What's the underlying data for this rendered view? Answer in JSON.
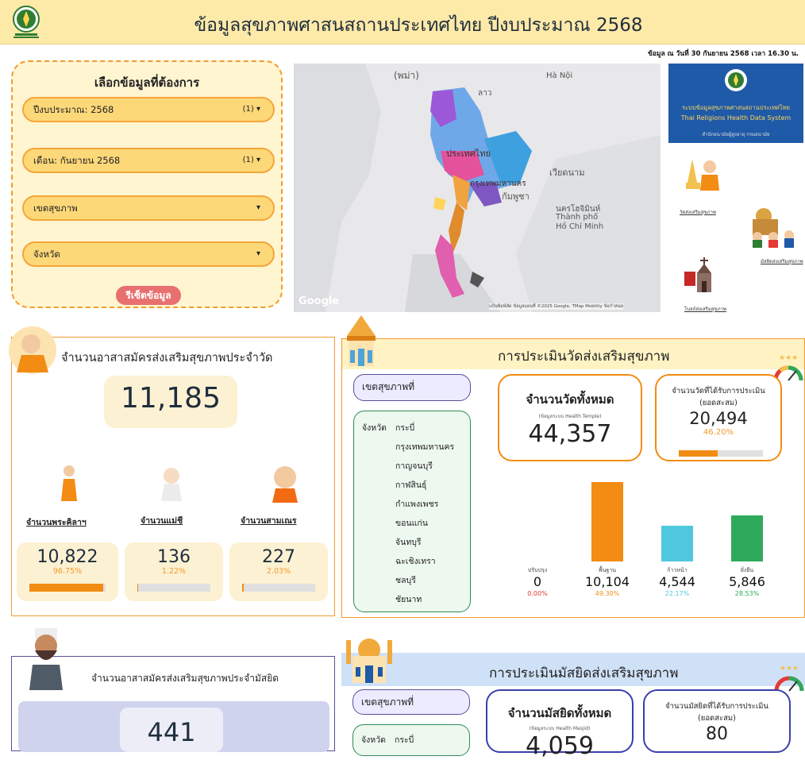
{
  "header": {
    "title": "ข้อมูลสุขภาพศาสนสถานประเทศไทย ปีงบประมาณ 2568"
  },
  "as_of": "ข้อมูล ณ วันที่ 30 กันยายน 2568 เวลา 16.30 น.",
  "filter": {
    "title": "เลือกข้อมูลที่ต้องการ",
    "fiscal_year": {
      "label": "ปีงบประมาณ: 2568",
      "count": "(1)"
    },
    "month": {
      "label": "เดือน: กันยายน 2568",
      "count": "(1)"
    },
    "health_zone": {
      "label": "เขตสุขภาพ"
    },
    "province": {
      "label": "จังหวัด"
    },
    "reset": "รีเซ็ตข้อมูล"
  },
  "map": {
    "labels": [
      "(พม่า)",
      "Hà Nội",
      "ลาว",
      "เวียดนาม",
      "กัมพูชา",
      "ประเทศไทย",
      "กรุงเทพมหานคร",
      "นครโฮจิมินห์",
      "Thành phố",
      "Hồ Chí Minh"
    ],
    "google": "Google",
    "attribution": "แป้นพิมพ์ลัด   ข้อมูลแผนที่ ©2025 Google, TMap Mobility   ข้อกำหนด"
  },
  "banner": {
    "line1": "ระบบข้อมูลสุขภาพศาสนสถานประเทศไทย",
    "line2": "Thai Religions Health Data System",
    "line3": "สำนักอนามัยผู้สูงอายุ กรมอนามัย"
  },
  "side_links": {
    "temple": "วัดส่งเสริมสุขภาพ",
    "mosque": "มัสยิดส่งเสริมสุขภาพ",
    "church": "โบสถ์ส่งเสริมสุขภาพ"
  },
  "temple_volunteers": {
    "title": "จำนวนอาสาสมัครส่งเสริมสุขภาพประจำวัด",
    "total": "11,185",
    "groups": [
      {
        "label": "จำนวนพระคิลาฯ",
        "value": "10,822",
        "pct": "96.75%",
        "fill": 96.75
      },
      {
        "label": "จำนวนแม่ชี",
        "value": "136",
        "pct": "1.22%",
        "fill": 1.22
      },
      {
        "label": "จำนวนสามเณร",
        "value": "227",
        "pct": "2.03%",
        "fill": 2.03
      }
    ]
  },
  "temple_assessment": {
    "title": "การประเมินวัดส่งเสริมสุขภาพ",
    "zone_label": "เขตสุขภาพที่",
    "province_label": "จังหวัด",
    "provinces": [
      "กระบี่",
      "กรุงเทพมหานคร",
      "กาญจนบุรี",
      "กาฬสินธุ์",
      "กำแพงเพชร",
      "ขอนแก่น",
      "จันทบุรี",
      "ฉะเชิงเทรา",
      "ชลบุรี",
      "ชัยนาท"
    ],
    "total_card": {
      "title": "จำนวนวัดทั้งหมด",
      "sub": "(ข้อมูลระบบ Health Temple)",
      "value": "44,357"
    },
    "assessed_card": {
      "title": "จำนวนวัดที่ได้รับการประเมิน",
      "sub": "(ยอดสะสม)",
      "value": "20,494",
      "pct": "46.20%",
      "fill": 46.2
    }
  },
  "chart_data": {
    "type": "bar",
    "categories": [
      "ปรับปรุง",
      "พื้นฐาน",
      "ก้าวหน้า",
      "ยั่งยืน"
    ],
    "values": [
      0,
      10104,
      4544,
      5846
    ],
    "value_labels": [
      "0",
      "10,104",
      "4,544",
      "5,846"
    ],
    "pct_labels": [
      "0.00%",
      "49.30%",
      "22.17%",
      "28.53%"
    ],
    "colors": [
      "#e53935",
      "#f28c12",
      "#4fc8de",
      "#2eaa5c"
    ]
  },
  "mosque_volunteers": {
    "title": "จำนวนอาสาสมัครส่งเสริมสุขภาพประจำมัสยิด",
    "total": "441"
  },
  "mosque_assessment": {
    "title": "การประเมินมัสยิดส่งเสริมสุขภาพ",
    "zone_label": "เขตสุขภาพที่",
    "province_label": "จังหวัด",
    "first_province": "กระบี่",
    "total_card": {
      "title": "จำนวนมัสยิดทั้งหมด",
      "sub": "(ข้อมูลระบบ Health Masjid)",
      "value": "4,059"
    },
    "assessed_card": {
      "title": "จำนวนมัสยิดที่ได้รับการประเมิน",
      "sub": "(ยอดสะสม)",
      "value": "80"
    }
  }
}
